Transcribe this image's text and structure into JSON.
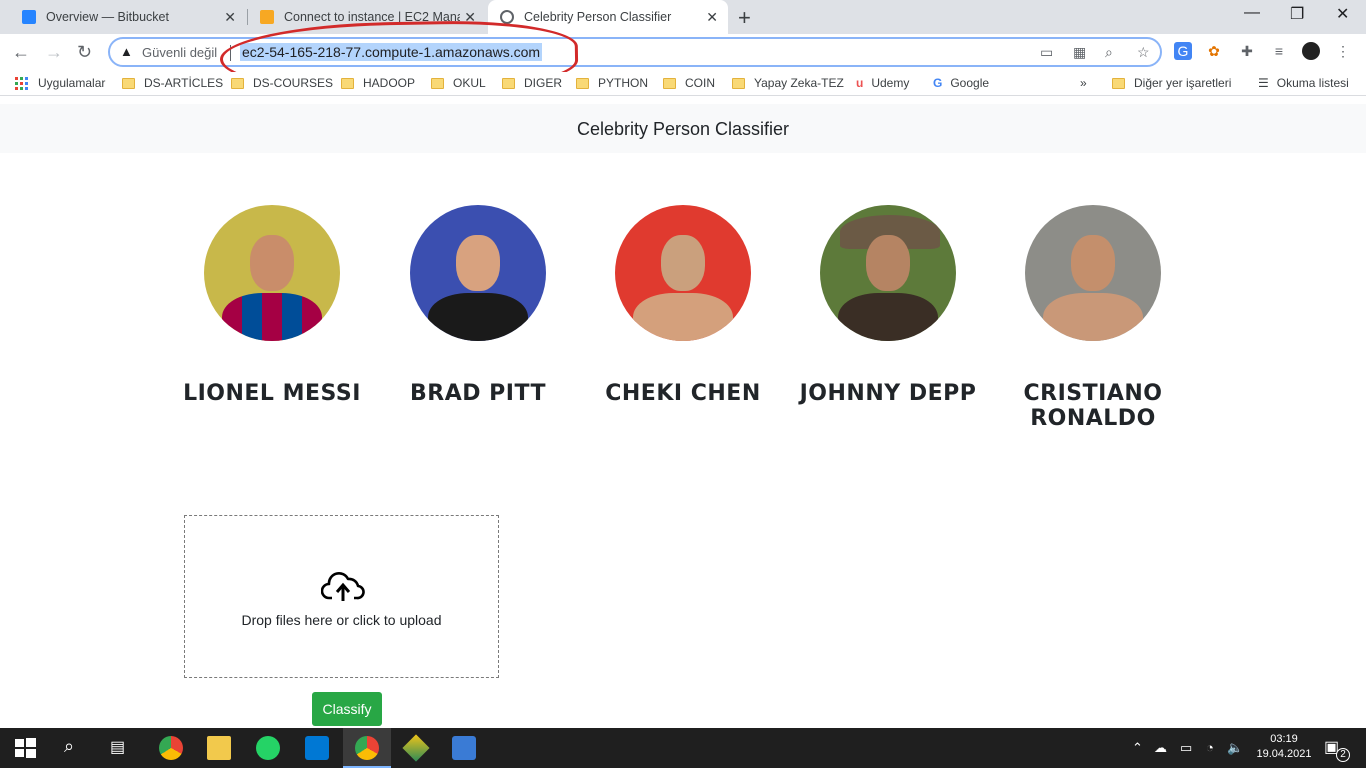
{
  "browser": {
    "tabs": [
      {
        "title": "Overview — Bitbucket",
        "favicon": "bitbucket-icon",
        "color": "#2684ff"
      },
      {
        "title": "Connect to instance | EC2 Manag",
        "favicon": "aws-icon",
        "color": "#f7a823"
      },
      {
        "title": "Celebrity Person Classifier",
        "favicon": "globe-icon",
        "color": "#5f6368"
      }
    ],
    "security_label": "Güvenli değil",
    "url": "ec2-54-165-218-77.compute-1.amazonaws.com"
  },
  "bookmarks": {
    "apps": "Uygulamalar",
    "items": [
      "DS-ARTİCLES",
      "DS-COURSES",
      "HADOOP",
      "OKUL",
      "DIGER",
      "PYTHON",
      "COIN",
      "Yapay Zeka-TEZ",
      "Udemy",
      "Google"
    ],
    "more": "»",
    "other": "Diğer yer işaretleri",
    "reading": "Okuma listesi"
  },
  "page": {
    "title": "Celebrity Person Classifier",
    "celebrities": [
      {
        "name": "LIONEL MESSI",
        "icon": "messi-photo"
      },
      {
        "name": "BRAD PITT",
        "icon": "brad-pitt-photo"
      },
      {
        "name": "CHEKI CHEN",
        "icon": "jackie-chan-photo"
      },
      {
        "name": "JOHNNY DEPP",
        "icon": "johnny-depp-photo"
      },
      {
        "name": "CRISTIANO RONALDO",
        "icon": "ronaldo-photo"
      }
    ],
    "dropzone_text": "Drop files here or click to upload",
    "classify_label": "Classify"
  },
  "taskbar": {
    "time": "03:19",
    "date": "19.04.2021",
    "notifications": "2"
  },
  "colors": {
    "accent": "#28a745",
    "annotation": "#d22a2a"
  }
}
